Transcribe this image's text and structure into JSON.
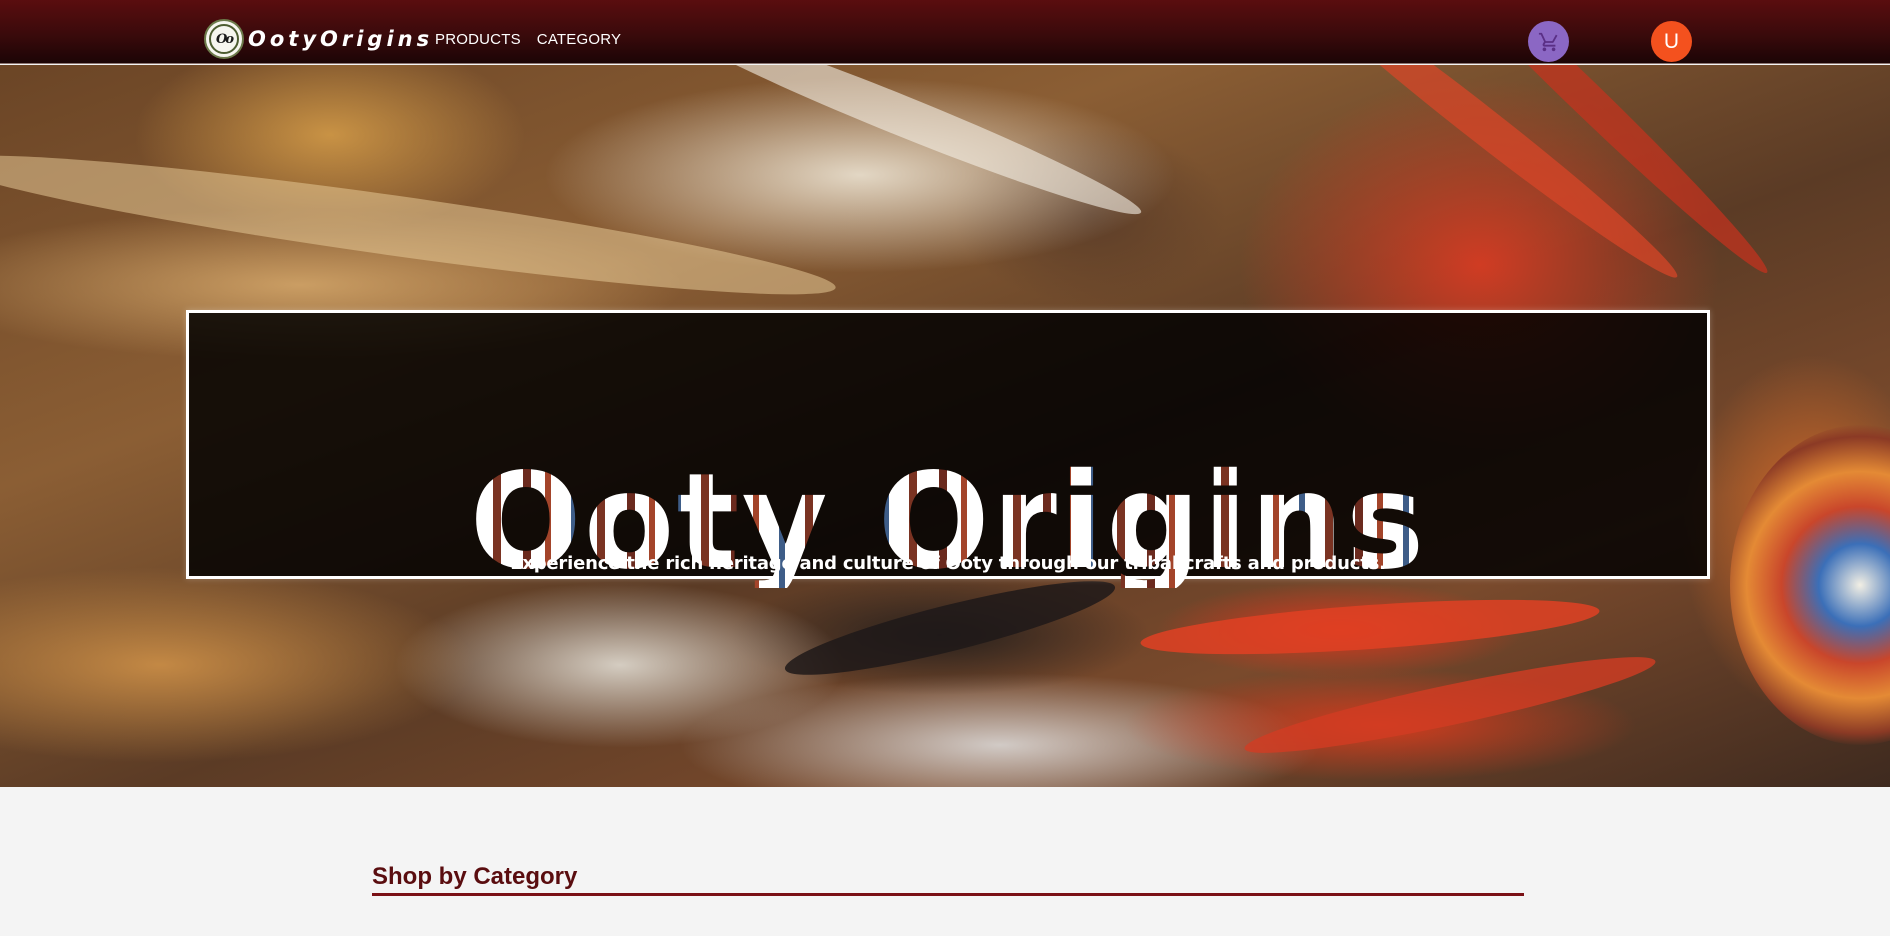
{
  "brand": {
    "name": "OotyOrigins",
    "logo_text": "Oo"
  },
  "nav": {
    "products": "PRODUCTS",
    "category": "CATEGORY"
  },
  "header_actions": {
    "cart_icon": "shopping-cart-icon",
    "user_initial": "U"
  },
  "hero": {
    "title": "Ooty Origins",
    "subtitle": "Experience the rich heritage and culture of Ooty through our tribal crafts and products."
  },
  "category_section": {
    "heading": "Shop by Category"
  },
  "colors": {
    "navbar": "#3a0a0b",
    "cart_button": "#8b67c4",
    "user_button": "#f4511e",
    "heading": "#5a0d0f",
    "underline": "#7a1015",
    "page_background": "#f4f4f4"
  }
}
